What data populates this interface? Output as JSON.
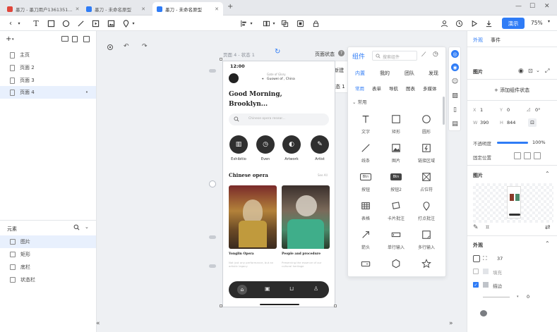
{
  "browser": {
    "tabs": [
      {
        "title": "墨刀 - 墨刀用户1361351..."
      },
      {
        "title": "墨刀 - 未命名原型"
      },
      {
        "title": "墨刀 - 未命名原型"
      }
    ]
  },
  "toolbar": {
    "publish_label": "演示",
    "zoom": "75%"
  },
  "left_panel": {
    "pages": [
      "主页",
      "页面 2",
      "页面 3",
      "页面 4"
    ],
    "elements_title": "元素",
    "elements": [
      "图片",
      "矩形",
      "底栏",
      "状态栏"
    ]
  },
  "canvas": {
    "frame_label": "页面 4 - 状态 1",
    "state_panel_title": "页面状态",
    "new_state": "+ 新建",
    "state_number": "1",
    "state_name": "状态 1"
  },
  "phone": {
    "time": "12:00",
    "location_top": "Gate of Glory",
    "location": "Guowei of , China",
    "greeting_line1": "Good Morning,",
    "greeting_line2": "Brooklyn...",
    "search_placeholder": "Chinese opera resear...",
    "categories": [
      "Exhibitio",
      "Even",
      "Artwork",
      "Artist"
    ],
    "section_title": "Chinese opera",
    "section_more": "See All",
    "cards": [
      {
        "title": "Yonglin Opera",
        "sub": "Not just any performance, but an artistic legacy"
      },
      {
        "title": "People and procedure",
        "sub": "Preserving the essence of our cultural heritage"
      }
    ]
  },
  "components": {
    "title": "组件",
    "search_placeholder": "搜索组件",
    "tabs": [
      "内置",
      "我的",
      "团队",
      "发现"
    ],
    "subtabs": [
      "常用",
      "表单",
      "导航",
      "图表",
      "多媒体"
    ],
    "group_title": "常用",
    "items": [
      {
        "label": "文字",
        "icon": "text-icon"
      },
      {
        "label": "矩形",
        "icon": "rectangle-icon"
      },
      {
        "label": "圆形",
        "icon": "circle-icon"
      },
      {
        "label": "线条",
        "icon": "line-icon"
      },
      {
        "label": "图片",
        "icon": "image-icon"
      },
      {
        "label": "链接区域",
        "icon": "link-area-icon"
      },
      {
        "label": "按钮",
        "icon": "button-icon"
      },
      {
        "label": "按钮2",
        "icon": "button2-icon"
      },
      {
        "label": "占位符",
        "icon": "placeholder-icon"
      },
      {
        "label": "表格",
        "icon": "table-icon"
      },
      {
        "label": "卡片批注",
        "icon": "card-note-icon"
      },
      {
        "label": "打点批注",
        "icon": "pin-note-icon"
      },
      {
        "label": "箭头",
        "icon": "arrow-icon"
      },
      {
        "label": "单行输入",
        "icon": "single-input-icon"
      },
      {
        "label": "多行输入",
        "icon": "multi-input-icon"
      },
      {
        "label": "",
        "icon": "toggle-icon"
      },
      {
        "label": "",
        "icon": "hexagon-icon"
      },
      {
        "label": "",
        "icon": "star-icon"
      }
    ],
    "btn_label": "Btn"
  },
  "right_panel": {
    "tab_appearance": "外观",
    "tab_events": "事件",
    "section_image": "图片",
    "add_state": "+ 添加组件状态",
    "x_label": "X",
    "x_value": "1",
    "y_label": "Y",
    "y_value": "0",
    "rotation": "0°",
    "w_label": "W",
    "w_value": "390",
    "h_label": "H",
    "h_value": "844",
    "opacity_label": "不透明度",
    "opacity_value": "100%",
    "opacity_fraction": 1.0,
    "fixed_label": "固定位置",
    "section_image2": "图片",
    "section_appearance": "外观",
    "radius_value": "37",
    "fill_label": "填充",
    "stroke_label": "描边",
    "stroke_value": "0",
    "accent": "#2f7cf6"
  }
}
